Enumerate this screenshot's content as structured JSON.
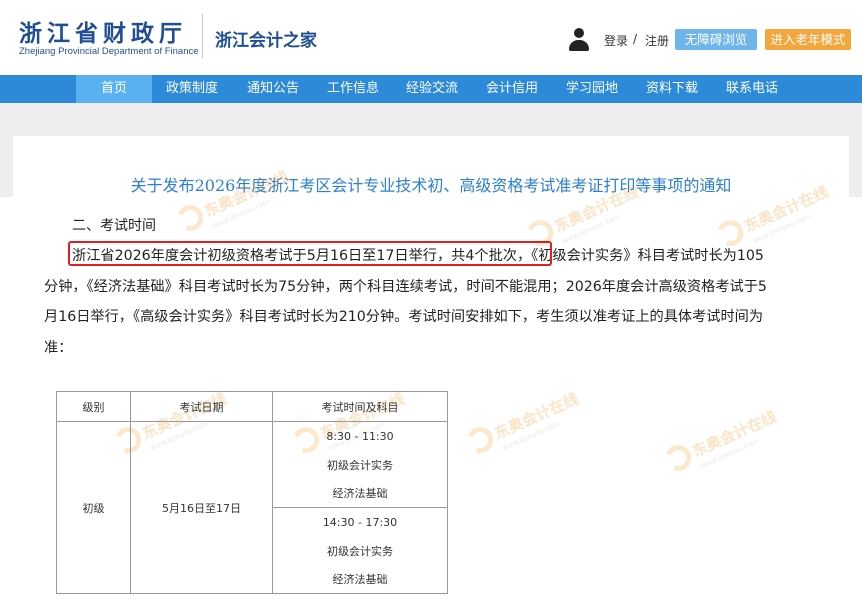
{
  "header": {
    "logo_cn": "浙江省财政厅",
    "logo_en": "Zhejiang Provincial Department of Finance",
    "site_name": "浙江会计之家",
    "login": "登录",
    "slash": "/",
    "register": "注册",
    "accessible_button": "无障碍浏览",
    "elder_button": "进入老年模式"
  },
  "nav": {
    "items": [
      "首页",
      "政策制度",
      "通知公告",
      "工作信息",
      "经验交流",
      "会计信用",
      "学习园地",
      "资料下载",
      "联系电话"
    ],
    "active": "首页"
  },
  "article": {
    "title": "关于发布2026年度浙江考区会计专业技术初、高级资格考试准考证打印等事项的通知",
    "section_heading": "二、考试时间",
    "paragraph_lines": [
      "浙江省2026年度会计初级资格考试于5月16日至17日举行，共4个批次，《初级会计实务》科目考试时长为105",
      "分钟，《经济法基础》科目考试时长为75分钟，两个科目连续考试，时间不能混用；2026年度会计高级资格考试于5",
      "月16日举行，《高级会计实务》科目考试时长为210分钟。考试时间安排如下，考生须以准考证上的具体考试时间为",
      "准："
    ]
  },
  "table": {
    "headers": [
      "级别",
      "考试日期",
      "考试时间及科目"
    ],
    "level": "初级",
    "date": "5月16日至17日",
    "sessions": [
      {
        "time": "8:30 - 11:30",
        "subjects": [
          "初级会计实务",
          "经济法基础"
        ]
      },
      {
        "time": "14:30 - 17:30",
        "subjects": [
          "初级会计实务",
          "经济法基础"
        ]
      }
    ]
  },
  "watermark": {
    "text": "东奥会计在线",
    "url": "www.dongao.com"
  },
  "colors": {
    "brand_blue": "#1f4e96",
    "nav_blue": "#2c8ad9",
    "title_blue": "#2c7fd1",
    "highlight_red": "#e02020",
    "elder_orange": "#f2a63c",
    "access_blue": "#6eb5ec"
  }
}
